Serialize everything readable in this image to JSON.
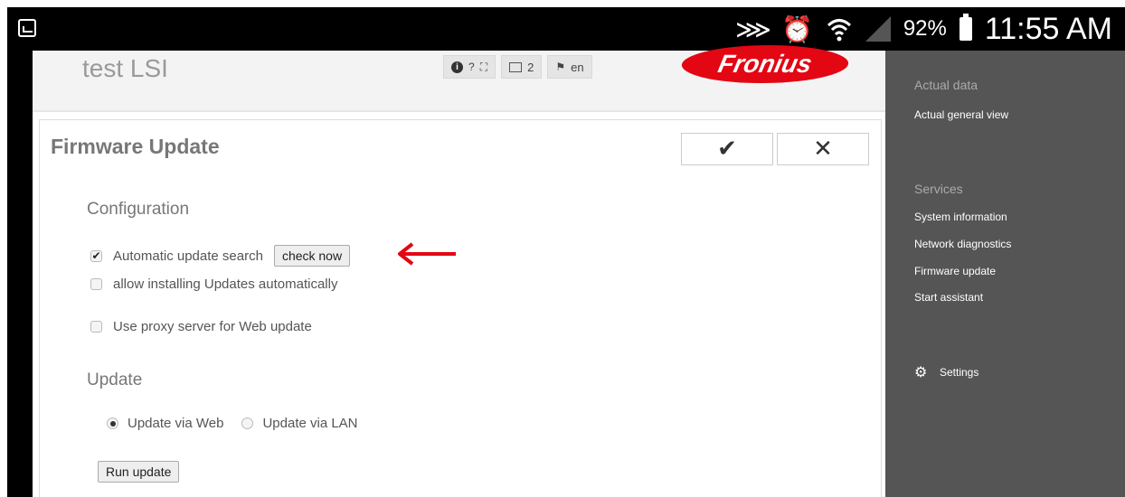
{
  "status_bar": {
    "battery_percent": "92%",
    "time": "11:55 AM",
    "icons": [
      "gallery-icon",
      "mute-icon",
      "alarm-icon",
      "wifi-icon",
      "signal-icon",
      "battery-icon"
    ]
  },
  "header": {
    "device_name": "test LSI",
    "tools": {
      "info": "i",
      "help": "?",
      "fullscreen": "⛶",
      "message_count": "2",
      "language": "en"
    },
    "logo_text": "Fronius"
  },
  "main": {
    "title": "Firmware Update",
    "confirm_symbol": "✔",
    "close_symbol": "✕",
    "configuration": {
      "title": "Configuration",
      "automatic_update_search": {
        "label": "Automatic update search",
        "checked": true
      },
      "check_now_label": "check now",
      "allow_installing": {
        "label": "allow installing Updates automatically",
        "checked": false
      },
      "use_proxy": {
        "label": "Use proxy server for Web update",
        "checked": false
      }
    },
    "update": {
      "title": "Update",
      "via_web": {
        "label": "Update via Web",
        "selected": true
      },
      "via_lan": {
        "label": "Update via LAN",
        "selected": false
      },
      "run_update_label": "Run update"
    },
    "annotation_arrow_color": "#e30613"
  },
  "sidebar": {
    "actual_data_heading": "Actual data",
    "actual_general_view": "Actual general view",
    "services_heading": "Services",
    "services_items": [
      "System information",
      "Network diagnostics",
      "Firmware update",
      "Start assistant"
    ],
    "settings_label": "Settings"
  },
  "colors": {
    "brand_red": "#e30613",
    "sidebar_bg": "#555555",
    "header_bg": "#f3f3f3"
  }
}
